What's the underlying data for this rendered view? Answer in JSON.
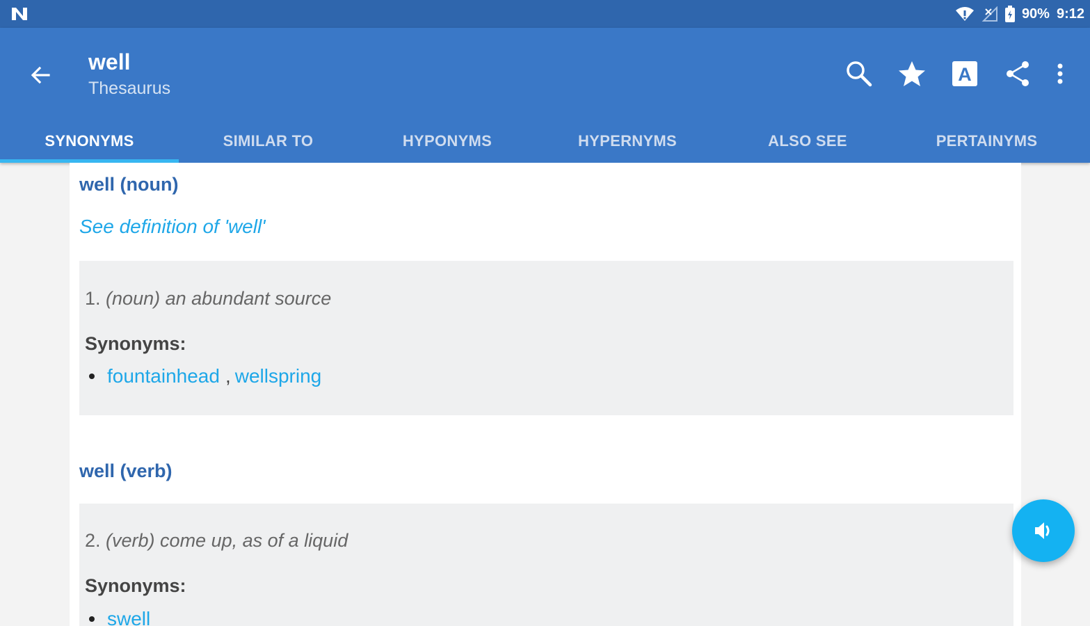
{
  "status_bar": {
    "battery": "90%",
    "time": "9:12",
    "icons": [
      "n-notification-icon",
      "wifi-icon",
      "no-signal-icon",
      "battery-icon"
    ]
  },
  "app_bar": {
    "title": "well",
    "subtitle": "Thesaurus",
    "background_color": "#3a78c7",
    "actions": [
      "search-icon",
      "star-icon",
      "text-size-icon",
      "share-icon",
      "more-vert-icon"
    ],
    "text_size_glyph": "A"
  },
  "tabs": [
    {
      "label": "SYNONYMS",
      "active": true
    },
    {
      "label": "SIMILAR TO",
      "active": false
    },
    {
      "label": "HYPONYMS",
      "active": false
    },
    {
      "label": "HYPERNYMS",
      "active": false
    },
    {
      "label": "ALSO SEE",
      "active": false
    },
    {
      "label": "PERTAINYMS",
      "active": false
    }
  ],
  "content": {
    "sections": [
      {
        "heading": "well (noun)",
        "see_definition": "See definition of 'well'",
        "senses": [
          {
            "number": "1.",
            "definition": "(noun) an abundant source",
            "synonyms_label": "Synonyms:",
            "synonyms": [
              "fountainhead",
              "wellspring"
            ],
            "separator": ","
          }
        ]
      },
      {
        "heading": "well (verb)",
        "senses": [
          {
            "number": "2.",
            "definition": "(verb) come up, as of a liquid",
            "synonyms_label": "Synonyms:",
            "synonyms": [
              "swell"
            ]
          }
        ]
      }
    ]
  },
  "fab": {
    "icon": "speaker-icon",
    "color": "#14b2f2"
  },
  "colors": {
    "accent": "#1ea7e8",
    "heading": "#2f66ad",
    "status_bar": "#2f66ad"
  }
}
